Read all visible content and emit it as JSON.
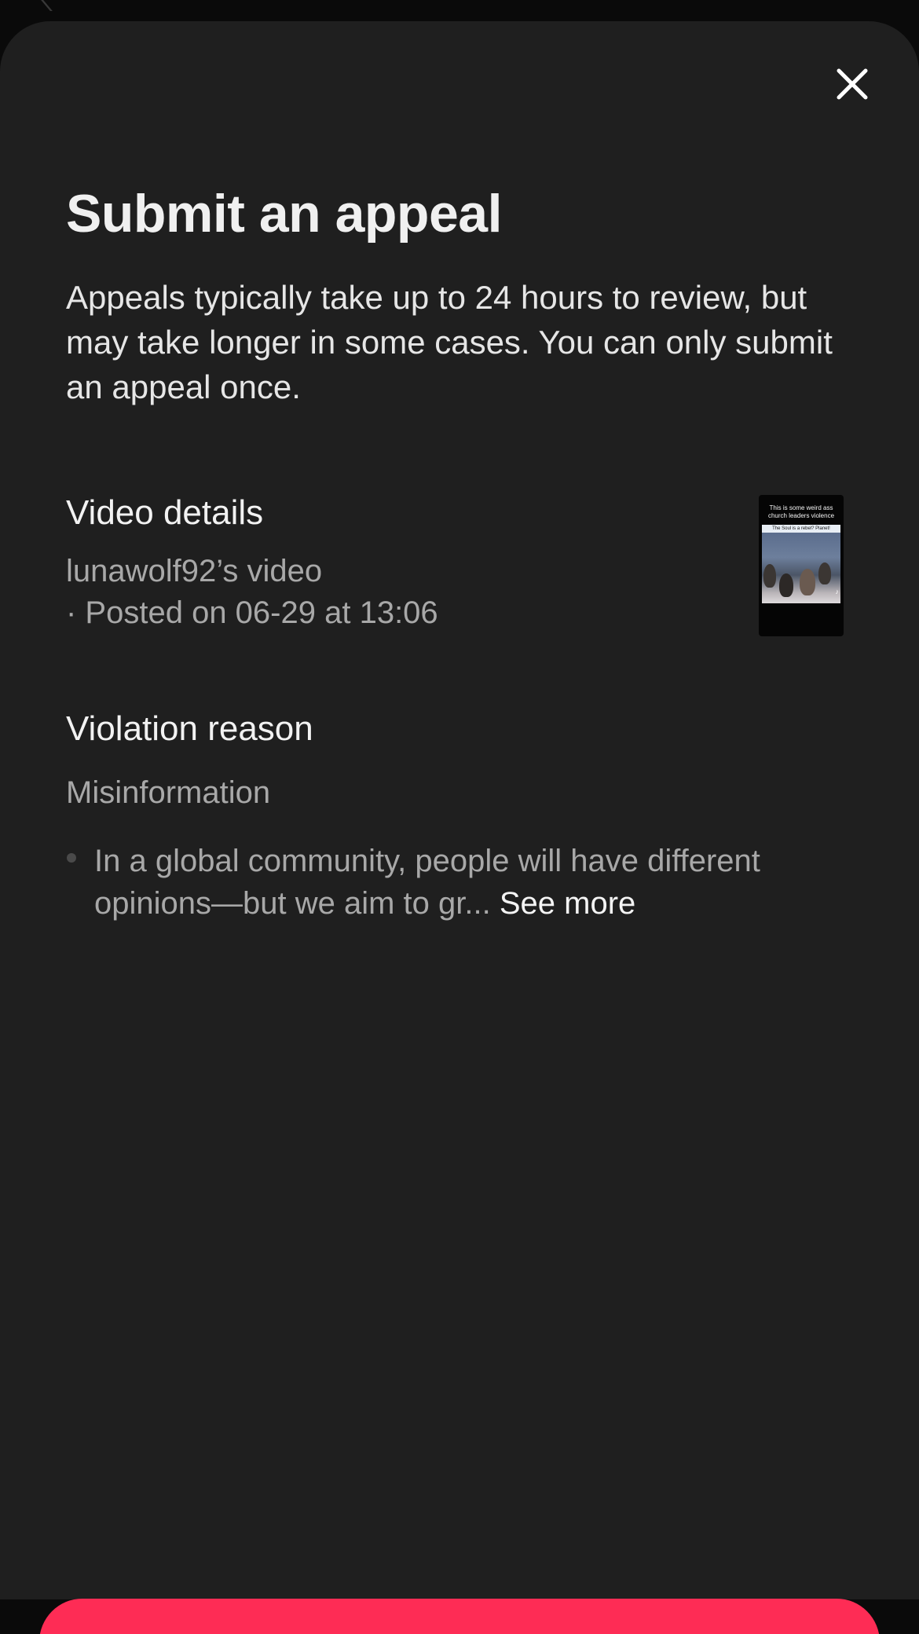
{
  "header": {
    "close_label": "Close"
  },
  "appeal": {
    "title": "Submit an appeal",
    "description": "Appeals typically take up to 24 hours to review, but may take longer in some cases. You can only submit an appeal once."
  },
  "video_details": {
    "heading": "Video details",
    "owner": "lunawolf92’s video",
    "posted": "· Posted on 06-29 at 13:06",
    "thumbnail": {
      "caption": "This is some weird ass church leaders violence",
      "banner": "The Soul is a rebel? Planet!"
    }
  },
  "violation": {
    "heading": "Violation reason",
    "reason": "Misinformation",
    "bullet_text": "In a global community, people will have different opinions—but we aim to gr...",
    "see_more": "See more"
  },
  "colors": {
    "sheet_bg": "#1f1f1f",
    "accent": "#fe2c55",
    "text_primary": "#f2f2f2",
    "text_secondary": "#a8a8a8"
  },
  "icons": {
    "close": "close-icon"
  }
}
